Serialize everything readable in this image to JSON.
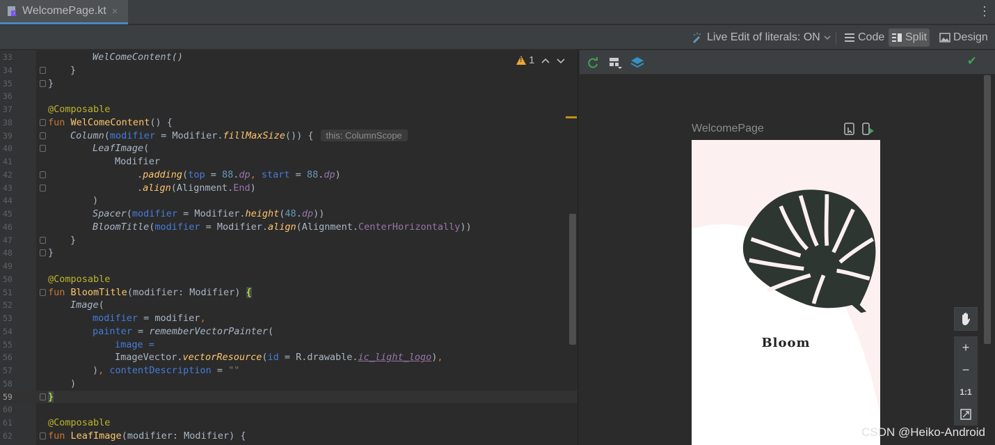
{
  "tab": {
    "title": "WelcomePage.kt",
    "close_glyph": "×",
    "menu_glyph": "⋮"
  },
  "viewbar": {
    "live_edit_label": "Live Edit of literals: ON",
    "code_label": "Code",
    "split_label": "Split",
    "design_label": "Design"
  },
  "editor": {
    "warning_count": "1",
    "hint_text": "this: ColumnScope",
    "line_numbers": [
      "33",
      "34",
      "35",
      "36",
      "37",
      "38",
      "39",
      "40",
      "41",
      "42",
      "43",
      "44",
      "45",
      "46",
      "47",
      "48",
      "49",
      "50",
      "51",
      "52",
      "53",
      "54",
      "55",
      "56",
      "57",
      "58",
      "59",
      "60",
      "61",
      "62"
    ]
  },
  "code": {
    "l33": "WelComeContent()",
    "l34": "}",
    "l35": "}",
    "l37": "@Composable",
    "l38_kw": "fun",
    "l38_fn": "WelComeContent",
    "l38_rest": "() {",
    "l39_a": "Column",
    "l39_b": "(",
    "l39_c": "modifier",
    "l39_d": " = Modifier.",
    "l39_e": "fillMaxSize",
    "l39_f": "()) {",
    "l40_a": "LeafImage",
    "l40_b": "(",
    "l41": "Modifier",
    "l42_a": ".",
    "l42_b": "padding",
    "l42_c": "(",
    "l42_d": "top",
    "l42_e": " = ",
    "l42_f": "88",
    "l42_g": ".",
    "l42_h": "dp",
    "l42_i": ", ",
    "l42_j": "start",
    "l42_k": " = ",
    "l42_l": "88",
    "l42_m": ".",
    "l42_n": "dp",
    "l42_o": ")",
    "l43_a": ".",
    "l43_b": "align",
    "l43_c": "(Alignment.",
    "l43_d": "End",
    "l43_e": ")",
    "l44": ")",
    "l45_a": "Spacer",
    "l45_b": "(",
    "l45_c": "modifier",
    "l45_d": " = Modifier.",
    "l45_e": "height",
    "l45_f": "(",
    "l45_g": "48",
    "l45_h": ".",
    "l45_i": "dp",
    "l45_j": "))",
    "l46_a": "BloomTitle",
    "l46_b": "(",
    "l46_c": "modifier",
    "l46_d": " = Modifier.",
    "l46_e": "align",
    "l46_f": "(Alignment.",
    "l46_g": "CenterHorizontally",
    "l46_h": "))",
    "l47": "}",
    "l48": "}",
    "l50": "@Composable",
    "l51_kw": "fun",
    "l51_fn": "BloomTitle",
    "l51_rest": "(modifier: Modifier) ",
    "l51_brace": "{",
    "l52_a": "Image",
    "l52_b": "(",
    "l53_a": "modifier",
    "l53_b": " = modifier",
    "l53_c": ",",
    "l54_a": "painter",
    "l54_b": " = ",
    "l54_c": "rememberVectorPainter",
    "l54_d": "(",
    "l55_a": "image",
    "l55_b": " =",
    "l56_a": "ImageVector.",
    "l56_b": "vectorResource",
    "l56_c": "(",
    "l56_d": "id",
    "l56_e": " = R.drawable.",
    "l56_f": "ic_light_logo",
    "l56_g": ")",
    "l56_h": ",",
    "l57_a": ")",
    "l57_b": ", ",
    "l57_c": "contentDescription",
    "l57_d": " = ",
    "l57_e": "\"\"",
    "l58": ")",
    "l59": "}",
    "l61": "@Composable",
    "l62_kw": "fun",
    "l62_fn": "LeafImage",
    "l62_rest": "(modifier: Modifier) {"
  },
  "preview": {
    "title": "WelcomePage",
    "bloom_text": "Bloom",
    "zoom_in": "+",
    "zoom_out": "−",
    "zoom_reset": "1:1",
    "check_glyph": "✔"
  },
  "colors": {
    "leaf": "#2d3630",
    "phone_bg": "#fdf0f0",
    "phone_white": "#ffffff",
    "accent_tab": "#4a88c7"
  },
  "watermark": "CSDN @Heiko-Android"
}
